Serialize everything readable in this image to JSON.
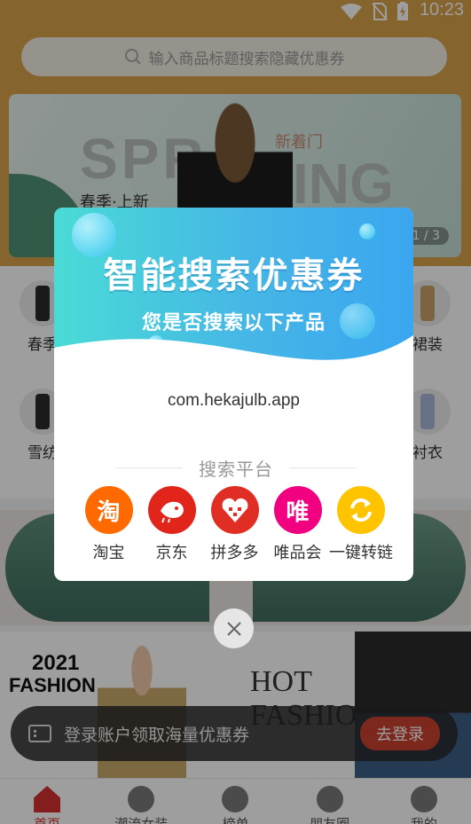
{
  "status_bar": {
    "time": "10:23"
  },
  "search": {
    "placeholder": "输入商品标题搜索隐藏优惠券"
  },
  "banner": {
    "text_spring_left": "SPR",
    "text_spring_right": "ING",
    "text_new_arrival": "新着门",
    "text_spring_new": "春季·上新",
    "page_indicator": "1 / 3"
  },
  "categories": [
    {
      "label": "春季"
    },
    {
      "label": "裙装"
    },
    {
      "label": "雪纺"
    },
    {
      "label": "衬衣"
    }
  ],
  "promo": {
    "year": "2021",
    "fashion": "FASHION",
    "hot": "HOT",
    "fashion_2": "FASHIO"
  },
  "login_bar": {
    "text": "登录账户领取海量优惠券",
    "button": "去登录"
  },
  "dialog": {
    "title": "智能搜索优惠券",
    "subtitle": "您是否搜索以下产品",
    "package_name": "com.hekajulb.app",
    "section_title": "搜索平台",
    "platforms": [
      {
        "label": "淘宝",
        "glyph": "淘",
        "color": "#ff6a00",
        "icon": "taobao-icon"
      },
      {
        "label": "京东",
        "glyph": "",
        "color": "#e1251b",
        "icon": "jd-icon"
      },
      {
        "label": "拼多多",
        "glyph": "",
        "color": "#e02e24",
        "icon": "pinduoduo-icon"
      },
      {
        "label": "唯品会",
        "glyph": "唯",
        "color": "#f10180",
        "icon": "vipshop-icon"
      },
      {
        "label": "一键转链",
        "glyph": "",
        "color": "#ffc400",
        "icon": "convert-link-icon"
      }
    ]
  },
  "tabbar": [
    {
      "label": "首页",
      "active": true
    },
    {
      "label": "潮流女装",
      "active": false
    },
    {
      "label": "榜单",
      "active": false
    },
    {
      "label": "朋友圈",
      "active": false
    },
    {
      "label": "我的",
      "active": false
    }
  ]
}
